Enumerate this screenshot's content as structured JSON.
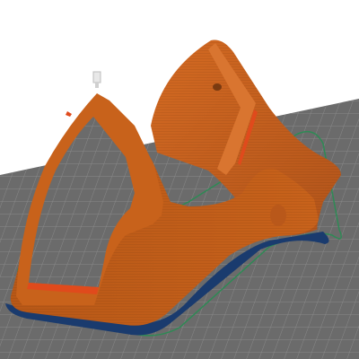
{
  "app": {
    "view": "3d-slicer-preview",
    "background_color": "#ffffff"
  },
  "scene": {
    "bed_color": "#6e6e6e",
    "grid_line_color": "#888888",
    "skirt_color": "#2e8a55",
    "brim_color": "#1a3b6e",
    "model_color": "#c8621b",
    "model_shadow_color": "#a24d12",
    "infill_highlight_color": "#e04a1c",
    "nozzle_marker_color": "#e8e8e8"
  }
}
